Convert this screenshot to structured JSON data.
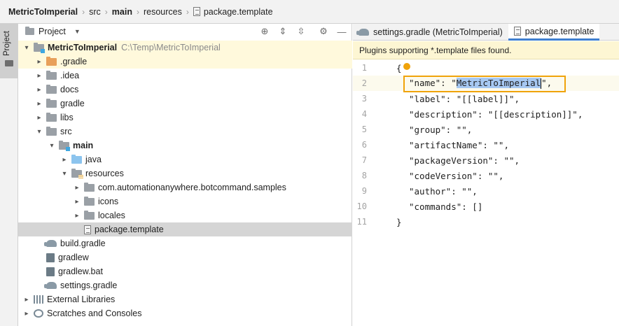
{
  "breadcrumb": {
    "items": [
      "MetricToImperial",
      "src",
      "main",
      "resources",
      "package.template"
    ]
  },
  "sidebar": {
    "project_tab_label": "Project"
  },
  "project_panel": {
    "title": "Project",
    "tree": [
      {
        "label": "MetricToImperial",
        "path": "C:\\Temp\\MetricToImperial",
        "depth": 0,
        "arrow": "▾",
        "icon": "module-folder-icon",
        "bold": true
      },
      {
        "label": ".gradle",
        "depth": 1,
        "arrow": "▸",
        "icon": "folder-orange-icon"
      },
      {
        "label": ".idea",
        "depth": 1,
        "arrow": "▸",
        "icon": "folder-icon"
      },
      {
        "label": "docs",
        "depth": 1,
        "arrow": "▸",
        "icon": "folder-icon"
      },
      {
        "label": "gradle",
        "depth": 1,
        "arrow": "▸",
        "icon": "folder-icon"
      },
      {
        "label": "libs",
        "depth": 1,
        "arrow": "▸",
        "icon": "folder-icon"
      },
      {
        "label": "src",
        "depth": 1,
        "arrow": "▾",
        "icon": "folder-icon"
      },
      {
        "label": "main",
        "depth": 2,
        "arrow": "▾",
        "icon": "module-folder-icon",
        "bold": true
      },
      {
        "label": "java",
        "depth": 3,
        "arrow": "▸",
        "icon": "source-folder-icon"
      },
      {
        "label": "resources",
        "depth": 3,
        "arrow": "▾",
        "icon": "resources-folder-icon"
      },
      {
        "label": "com.automationanywhere.botcommand.samples",
        "depth": 4,
        "arrow": "▸",
        "icon": "folder-icon"
      },
      {
        "label": "icons",
        "depth": 4,
        "arrow": "▸",
        "icon": "folder-icon"
      },
      {
        "label": "locales",
        "depth": 4,
        "arrow": "▸",
        "icon": "folder-icon"
      },
      {
        "label": "package.template",
        "depth": 4,
        "arrow": "",
        "icon": "file-icon",
        "selected": true
      },
      {
        "label": "build.gradle",
        "depth": 1,
        "arrow": "",
        "icon": "gradle-elephant-icon"
      },
      {
        "label": "gradlew",
        "depth": 1,
        "arrow": "",
        "icon": "file-icon"
      },
      {
        "label": "gradlew.bat",
        "depth": 1,
        "arrow": "",
        "icon": "file-icon"
      },
      {
        "label": "settings.gradle",
        "depth": 1,
        "arrow": "",
        "icon": "gradle-elephant-icon"
      },
      {
        "label": "External Libraries",
        "depth": 0,
        "arrow": "▸",
        "icon": "library-icon"
      },
      {
        "label": "Scratches and Consoles",
        "depth": 0,
        "arrow": "▸",
        "icon": "scratch-icon"
      }
    ]
  },
  "editor": {
    "tabs": [
      {
        "label": "settings.gradle (MetricToImperial)",
        "active": false
      },
      {
        "label": "package.template",
        "active": true
      }
    ],
    "notice": "Plugins supporting *.template files found.",
    "lines": [
      {
        "num": "1",
        "text": "{"
      },
      {
        "num": "2",
        "pre": "\"name\": \"",
        "selected": "MetricToImperial",
        "post": "\","
      },
      {
        "num": "3",
        "text": "\"label\": \"[[label]]\","
      },
      {
        "num": "4",
        "text": "\"description\": \"[[description]]\","
      },
      {
        "num": "5",
        "text": "\"group\": \"\","
      },
      {
        "num": "6",
        "text": "\"artifactName\": \"\","
      },
      {
        "num": "7",
        "text": "\"packageVersion\": \"\","
      },
      {
        "num": "8",
        "text": "\"codeVersion\": \"\","
      },
      {
        "num": "9",
        "text": "\"author\": \"\","
      },
      {
        "num": "10",
        "text": "\"commands\": []"
      },
      {
        "num": "11",
        "text": "}"
      }
    ]
  },
  "colors": {
    "highlight_box": "#f0a30a",
    "selection": "#a6c8f2",
    "active_tab_underline": "#3f7fd0",
    "notice_bg": "#fdf6d3"
  }
}
